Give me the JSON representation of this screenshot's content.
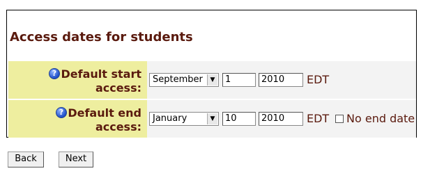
{
  "section": {
    "title": "Access dates for students"
  },
  "start": {
    "label_line1": "Default start",
    "label_line2": "access:",
    "month": "September",
    "day": "1",
    "year": "2010",
    "timezone": "EDT"
  },
  "end": {
    "label_line1": "Default end",
    "label_line2": "access:",
    "month": "January",
    "day": "10",
    "year": "2010",
    "timezone": "EDT",
    "no_end_label": "No end date",
    "no_end_checked": false
  },
  "help_icon_glyph": "?",
  "buttons": {
    "back": "Back",
    "next": "Next"
  },
  "colors": {
    "label_text": "#5a1a0e",
    "label_bg": "#eeee9f",
    "field_bg": "#f3f3f3"
  }
}
